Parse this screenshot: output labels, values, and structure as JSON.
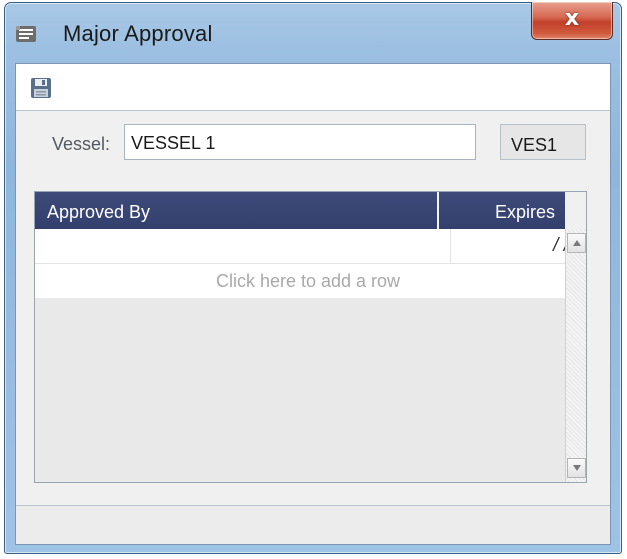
{
  "window": {
    "title": "Major Approval",
    "close_label": "x"
  },
  "toolbar": {
    "save_icon": "save-icon"
  },
  "form": {
    "vessel_label": "Vessel:",
    "vessel_value": "VESSEL 1",
    "vessel_code": "VES1"
  },
  "grid": {
    "columns": [
      "Approved By",
      "Expires"
    ],
    "rows": [
      {
        "approved_by": "",
        "expires": "/ /"
      }
    ],
    "add_row_text": "Click here to add a row"
  },
  "colors": {
    "header_bg": "#3a4573",
    "close_red": "#c8452d",
    "frame_blue": "#9dc0e2"
  }
}
